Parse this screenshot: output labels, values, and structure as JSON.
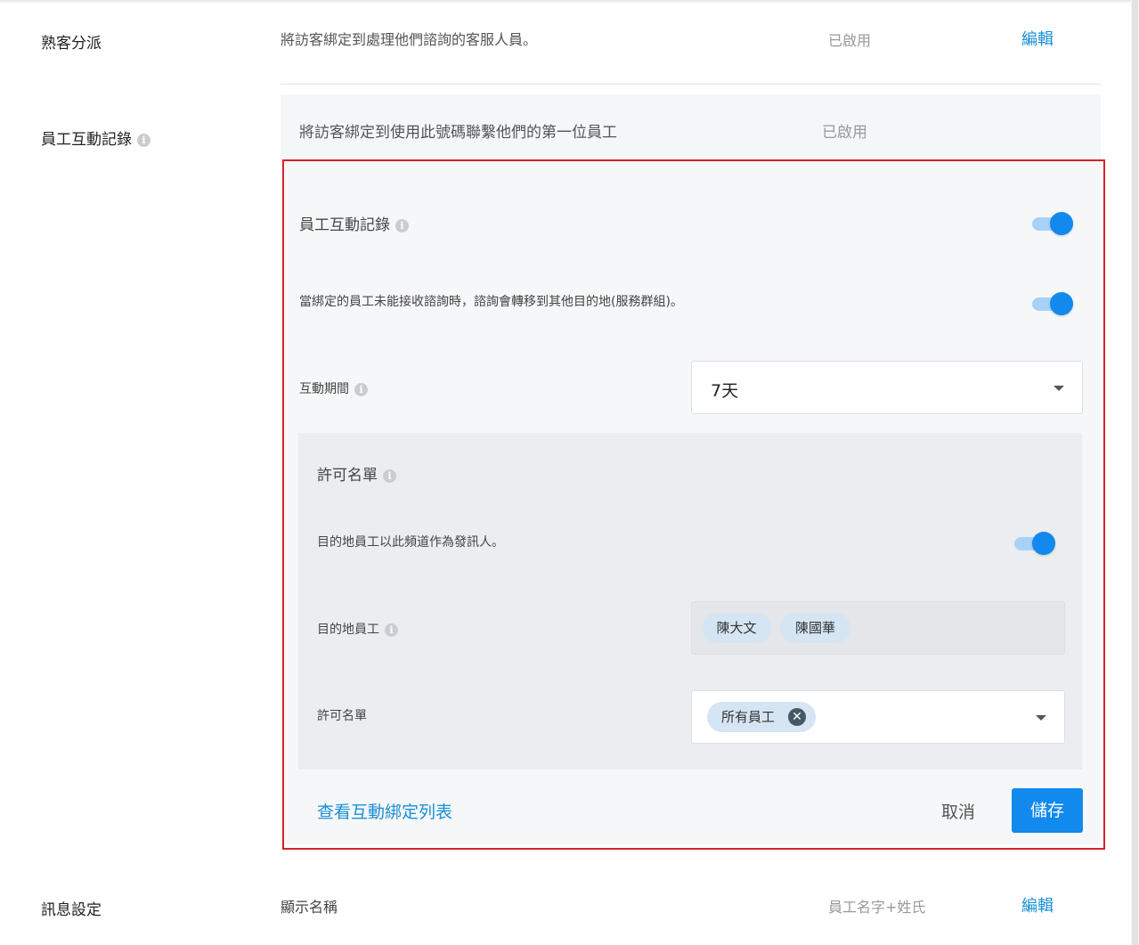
{
  "rows": {
    "repeat_visitor": {
      "label": "熟客分派",
      "description": "將訪客綁定到處理他們諮詢的客服人員。",
      "status": "已啟用",
      "edit_label": "編輯"
    },
    "staff_interaction": {
      "label": "員工互動記錄",
      "header_description": "將訪客綁定到使用此號碼聯繫他們的第一位員工",
      "header_status": "已啟用"
    },
    "message_settings": {
      "label": "訊息設定",
      "description": "顯示名稱",
      "status": "員工名字+姓氏",
      "edit_label": "編輯"
    }
  },
  "editor": {
    "interaction_record": {
      "label": "員工互動記錄",
      "enabled": true
    },
    "transfer_when_unavailable": {
      "label": "當綁定的員工未能接收諮詢時，諮詢會轉移到其他目的地(服務群組)。",
      "enabled": true
    },
    "interaction_period": {
      "label": "互動期間",
      "value": "7天"
    },
    "allowlist": {
      "title": "許可名單",
      "sender_toggle": {
        "label": "目的地員工以此頻道作為發訊人。",
        "enabled": true
      },
      "destination_staff": {
        "label": "目的地員工",
        "chips": [
          "陳大文",
          "陳國華"
        ]
      },
      "allow_list": {
        "label": "許可名單",
        "chip": "所有員工"
      }
    },
    "view_bindings_link": "查看互動綁定列表",
    "cancel_label": "取消",
    "save_label": "儲存"
  },
  "icons": {
    "info": "info-icon",
    "dropdown": "chevron-down-icon",
    "remove": "close-icon"
  },
  "colors": {
    "accent": "#1289ec",
    "link": "#1a8fd6",
    "highlight_frame": "#d9202a"
  }
}
